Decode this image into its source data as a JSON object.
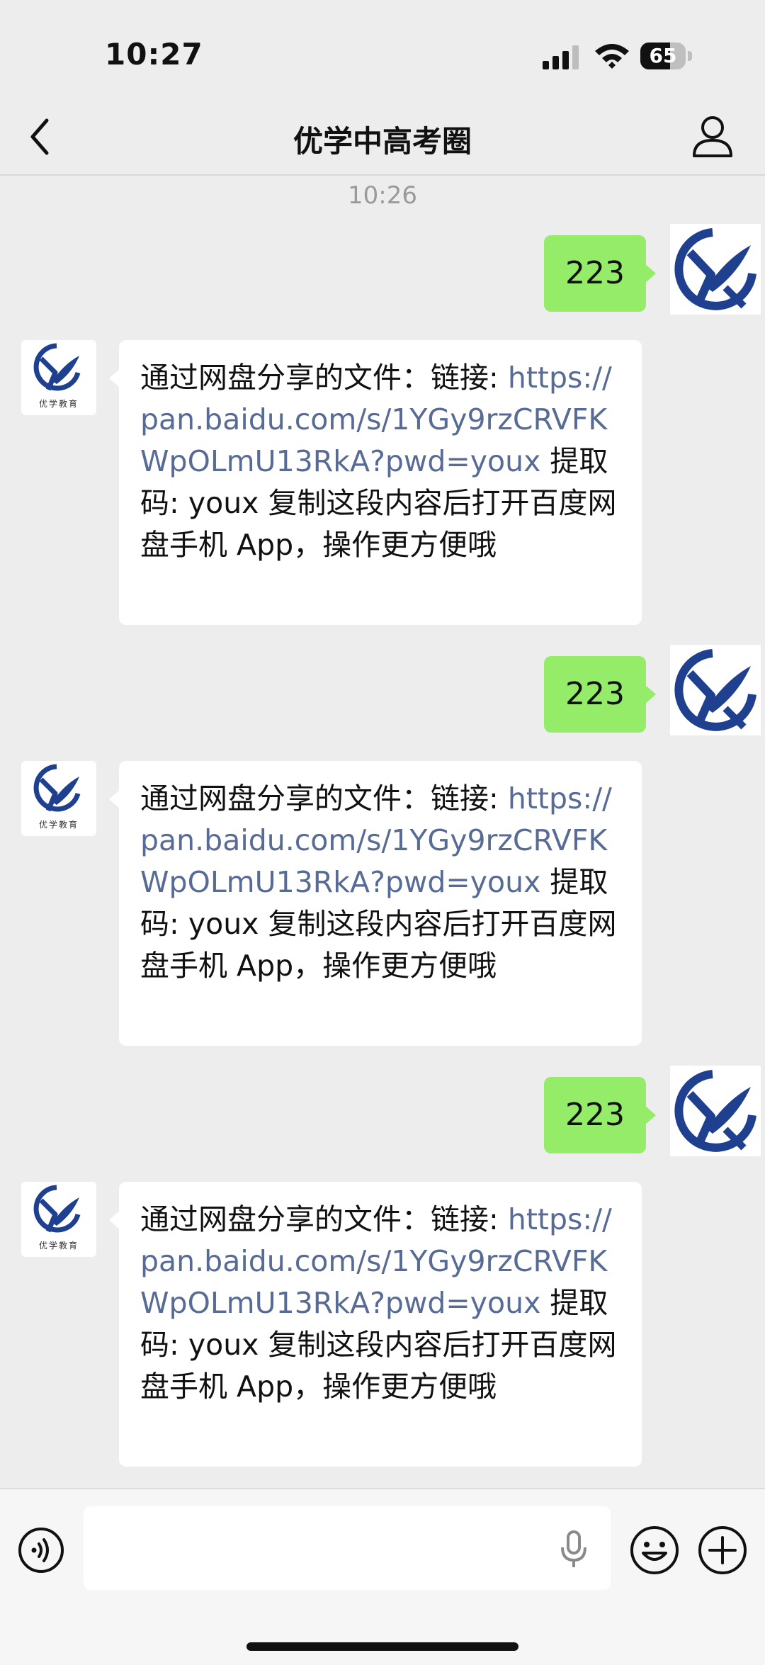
{
  "status_bar": {
    "time": "10:27",
    "battery": "65",
    "battery_level": 0.65
  },
  "nav": {
    "title": "优学中高考圈"
  },
  "chat": {
    "timestamp": "10:26",
    "outgoing_text": "223",
    "incoming": {
      "prefix": "通过网盘分享的文件：链接: ",
      "link": "https://pan.baidu.com/s/1YGy9rzCRVFKWpOLmU13RkA?pwd=youx",
      "suffix": " 提取码: youx 复制这段内容后打开百度网盘手机 App，操作更方便哦"
    },
    "contact_avatar_label": "优学教育"
  },
  "colors": {
    "outgoing_bubble": "#95ec69",
    "link": "#576b95",
    "logo_blue": "#1f3f8f"
  },
  "icons": [
    "back-icon",
    "profile-icon",
    "voice-icon",
    "mic-icon",
    "emoji-icon",
    "plus-icon"
  ]
}
